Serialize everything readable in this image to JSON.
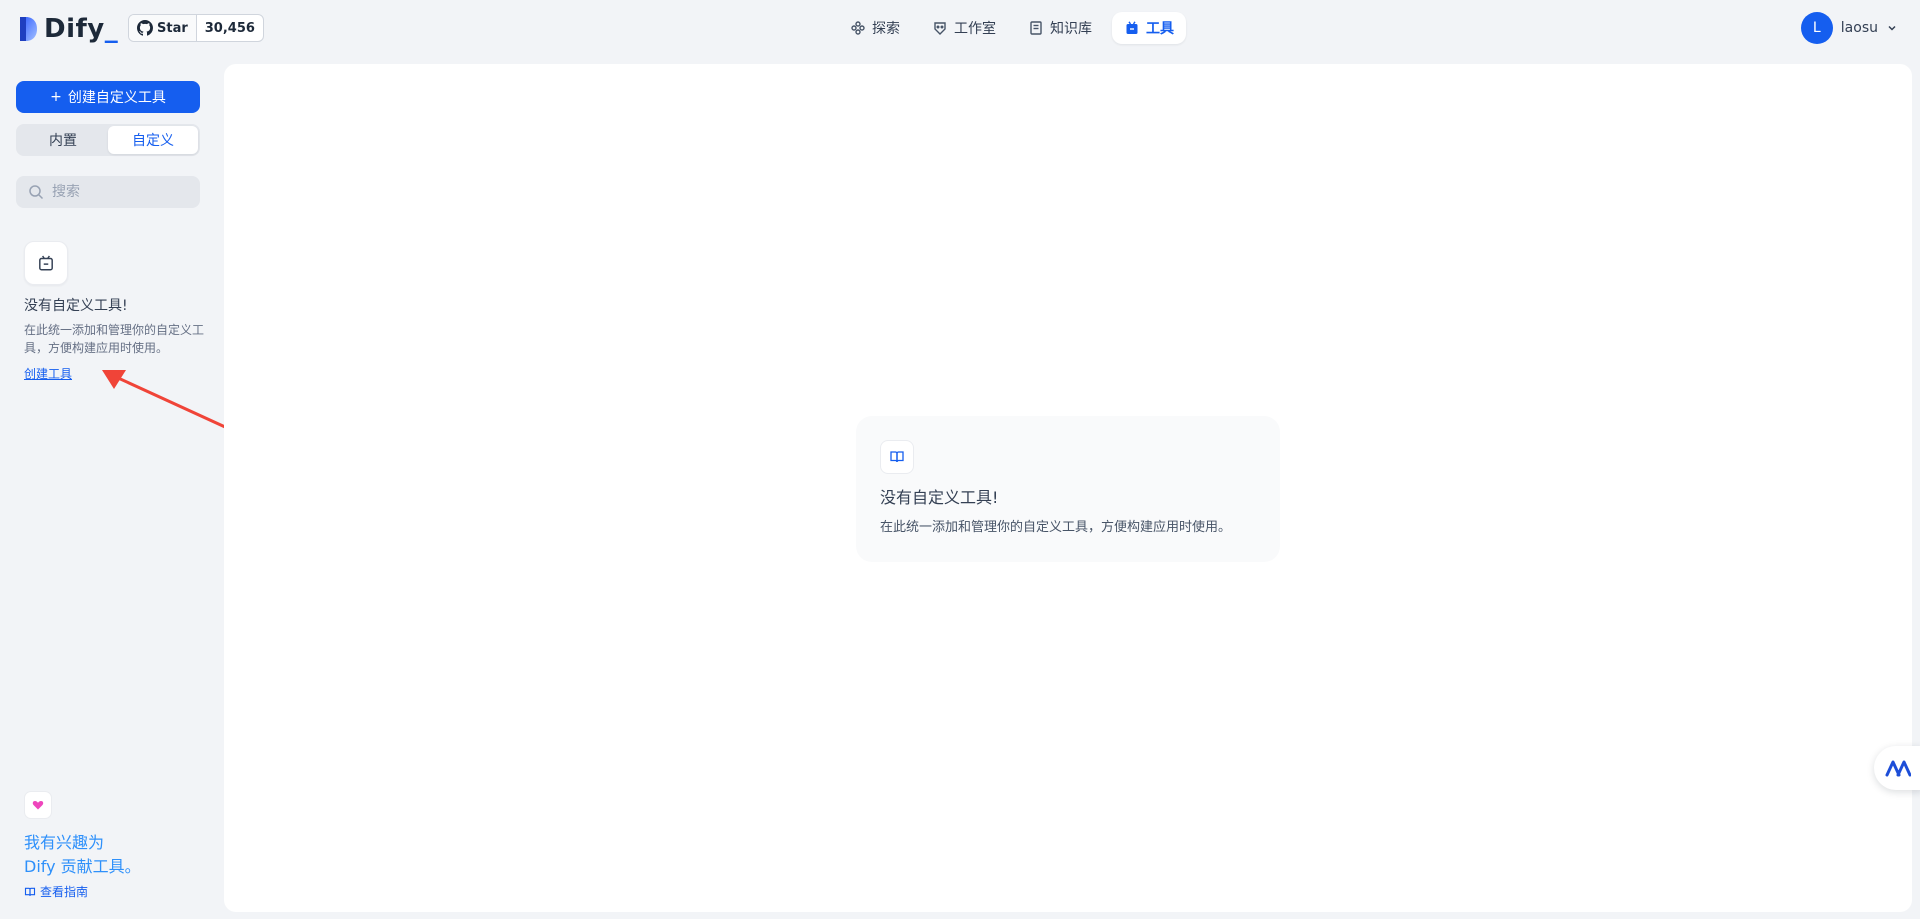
{
  "header": {
    "logo_text": "Dify",
    "github": {
      "star_label": "Star",
      "count": "30,456"
    },
    "nav": [
      {
        "label": "探索",
        "icon": "explore-icon"
      },
      {
        "label": "工作室",
        "icon": "studio-icon"
      },
      {
        "label": "知识库",
        "icon": "knowledge-icon"
      },
      {
        "label": "工具",
        "icon": "tools-icon",
        "active": true
      }
    ],
    "user": {
      "avatar_initial": "L",
      "name": "laosu"
    }
  },
  "sidebar": {
    "create_button": "创建自定义工具",
    "tabs": [
      {
        "label": "内置",
        "active": false
      },
      {
        "label": "自定义",
        "active": true
      }
    ],
    "search_placeholder": "搜索",
    "empty": {
      "title": "没有自定义工具!",
      "description": "在此统一添加和管理你的自定义工具，方便构建应用时使用。",
      "link": "创建工具"
    },
    "contribute": {
      "line1": "我有兴趣为",
      "line2": "Dify 贡献工具。",
      "guide": "查看指南"
    }
  },
  "main": {
    "empty": {
      "title": "没有自定义工具!",
      "description": "在此统一添加和管理你的自定义工具，方便构建应用时使用。"
    }
  },
  "colors": {
    "accent": "#155eef",
    "background": "#f2f4f7",
    "annotation_arrow": "#f04438"
  }
}
